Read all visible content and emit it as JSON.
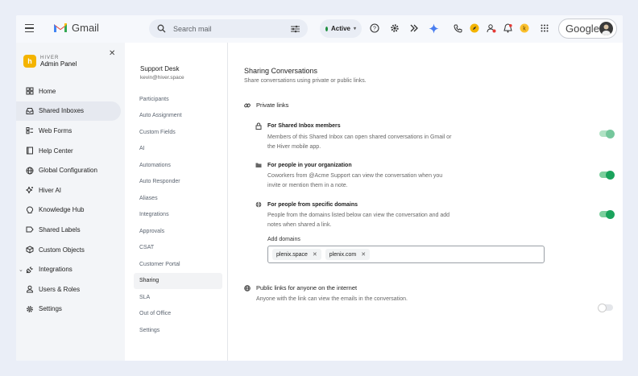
{
  "topbar": {
    "app_name": "Gmail",
    "search_placeholder": "Search mail",
    "status_label": "Active",
    "account_label": "Google"
  },
  "sidebar": {
    "brand_small": "HIVER",
    "brand_title": "Admin Panel",
    "items": [
      {
        "label": "Home",
        "icon": "home-icon"
      },
      {
        "label": "Shared Inboxes",
        "icon": "inbox-icon",
        "active": true
      },
      {
        "label": "Web Forms",
        "icon": "forms-icon"
      },
      {
        "label": "Help Center",
        "icon": "book-icon"
      },
      {
        "label": "Global Configuration",
        "icon": "globe-icon"
      },
      {
        "label": "Hiver AI",
        "icon": "sparkle-icon"
      },
      {
        "label": "Knowledge Hub",
        "icon": "bulb-icon"
      },
      {
        "label": "Shared Labels",
        "icon": "label-icon"
      },
      {
        "label": "Custom Objects",
        "icon": "cube-icon"
      },
      {
        "label": "Integrations",
        "icon": "plug-icon",
        "expandable": true
      },
      {
        "label": "Users & Roles",
        "icon": "user-icon"
      },
      {
        "label": "Settings",
        "icon": "gear-icon"
      }
    ]
  },
  "inbox": {
    "name": "Support Desk",
    "email": "kevin@hiver.space",
    "menu": [
      "Participants",
      "Auto Assignment",
      "Custom Fields",
      "AI",
      "Automations",
      "Auto Responder",
      "Aliases",
      "Integrations",
      "Approvals",
      "CSAT",
      "Customer Portal",
      "Sharing",
      "SLA",
      "Out of Office",
      "Settings"
    ],
    "active_menu": "Sharing"
  },
  "content": {
    "title": "Sharing Conversations",
    "subtitle": "Share conversations using private or public links.",
    "private_section": "Private links",
    "options": [
      {
        "title": "For Shared Inbox members",
        "desc": "Members of this Shared Inbox can open shared conversations in Gmail or the Hiver mobile app.",
        "enabled": true
      },
      {
        "title": "For people in your organization",
        "desc": "Coworkers from @Acme Support can view the conversation when you invite or mention them in a note.",
        "enabled": true
      },
      {
        "title": "For people from specific domains",
        "desc": "People from the domains listed below can view the conversation and add notes when shared a link.",
        "enabled": true
      }
    ],
    "domains_label": "Add domains",
    "domains": [
      "plenix.space",
      "plenix.com"
    ],
    "public": {
      "title": "Public links for anyone on the internet",
      "desc": "Anyone with the link can view the emails in the conversation.",
      "enabled": false
    }
  },
  "colors": {
    "toggle_on": "#1aa35c",
    "active_status": "#1e8e3e",
    "hiver_brand": "#f4b400"
  }
}
